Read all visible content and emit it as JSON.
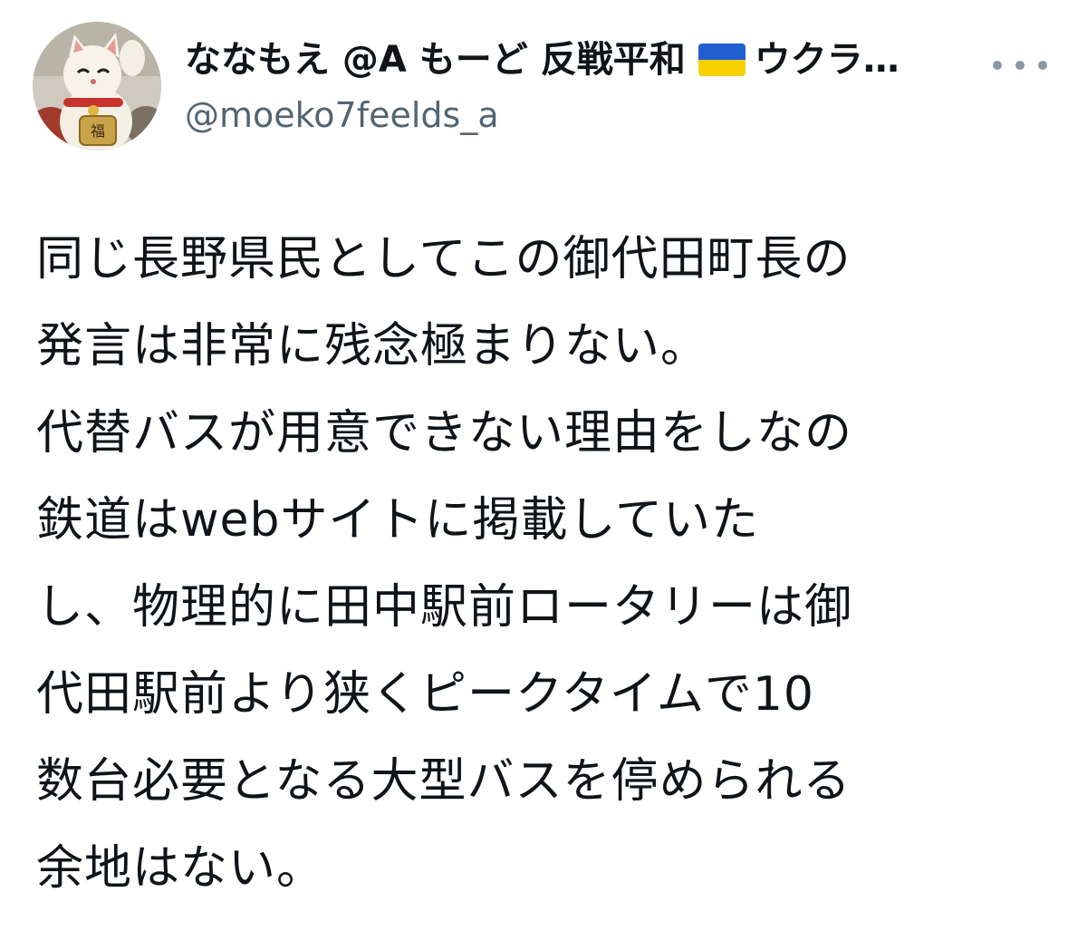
{
  "author": {
    "display_name_prefix": "ななもえ @A もーど 反戦平和",
    "flag_icon": "ukraine-flag-icon",
    "display_name_suffix": "ウクラ…",
    "handle": "@moeko7feelds_a",
    "avatar_icon": "maneki-neko-avatar"
  },
  "more_button": {
    "icon": "more-horizontal-icon"
  },
  "tweet": {
    "lines": [
      "同じ長野県民としてこの御代田町長の",
      "発言は非常に残念極まりない。",
      "代替バスが用意できない理由をしなの",
      "鉄道はwebサイトに掲載していた",
      "し、物理的に田中駅前ロータリーは御",
      "代田駅前より狭くピークタイムで10",
      "数台必要となる大型バスを停められる",
      "余地はない。"
    ]
  },
  "colors": {
    "text": "#0f1419",
    "secondary_text": "#536471",
    "flag_blue": "#1f5fd0",
    "flag_yellow": "#f7d000"
  }
}
